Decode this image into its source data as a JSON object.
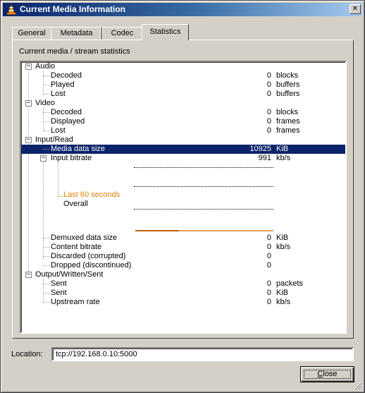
{
  "window": {
    "title": "Current Media Information",
    "close_glyph": "✕",
    "icon": "vlc-cone-icon"
  },
  "tabs": [
    {
      "label": "General",
      "active": false
    },
    {
      "label": "Metadata",
      "active": false
    },
    {
      "label": "Codec",
      "active": false
    },
    {
      "label": "Statistics",
      "active": true
    }
  ],
  "panel": {
    "caption": "Current media / stream statistics"
  },
  "tree": {
    "audio": {
      "label": "Audio",
      "items": [
        {
          "label": "Decoded",
          "value": "0",
          "unit": "blocks"
        },
        {
          "label": "Played",
          "value": "0",
          "unit": "buffers"
        },
        {
          "label": "Lost",
          "value": "0",
          "unit": "buffers"
        }
      ]
    },
    "video": {
      "label": "Video",
      "items": [
        {
          "label": "Decoded",
          "value": "0",
          "unit": "blocks"
        },
        {
          "label": "Displayed",
          "value": "0",
          "unit": "frames"
        },
        {
          "label": "Lost",
          "value": "0",
          "unit": "frames"
        }
      ]
    },
    "input": {
      "label": "Input/Read",
      "media_data_size": {
        "label": "Media data size",
        "value": "10925",
        "unit": "KiB"
      },
      "input_bitrate": {
        "label": "Input bitrate",
        "value": "991",
        "unit": "kb/s"
      },
      "graph": {
        "last_label": "Last 60 seconds",
        "overall_label": "Overall"
      },
      "items": [
        {
          "label": "Demuxed data size",
          "value": "0",
          "unit": "KiB"
        },
        {
          "label": "Content bitrate",
          "value": "0",
          "unit": "kb/s"
        },
        {
          "label": "Discarded (corrupted)",
          "value": "0",
          "unit": ""
        },
        {
          "label": "Dropped (discontinued)",
          "value": "0",
          "unit": ""
        }
      ]
    },
    "output": {
      "label": "Output/Written/Sent",
      "items": [
        {
          "label": "Sent",
          "value": "0",
          "unit": "packets"
        },
        {
          "label": "Sent",
          "value": "0",
          "unit": "KiB"
        },
        {
          "label": "Upstream rate",
          "value": "0",
          "unit": "kb/s"
        }
      ]
    }
  },
  "location": {
    "label": "Location:",
    "value": "tcp://192.168.0.10:5000"
  },
  "buttons": {
    "close_label": "Close",
    "close_mnemonic": "C",
    "close_rest": "lose"
  },
  "colors": {
    "title_start": "#0a246a",
    "title_end": "#a6caf0",
    "selection": "#0a246a",
    "graph_accent": "#e08000",
    "face": "#d4d0c8"
  }
}
